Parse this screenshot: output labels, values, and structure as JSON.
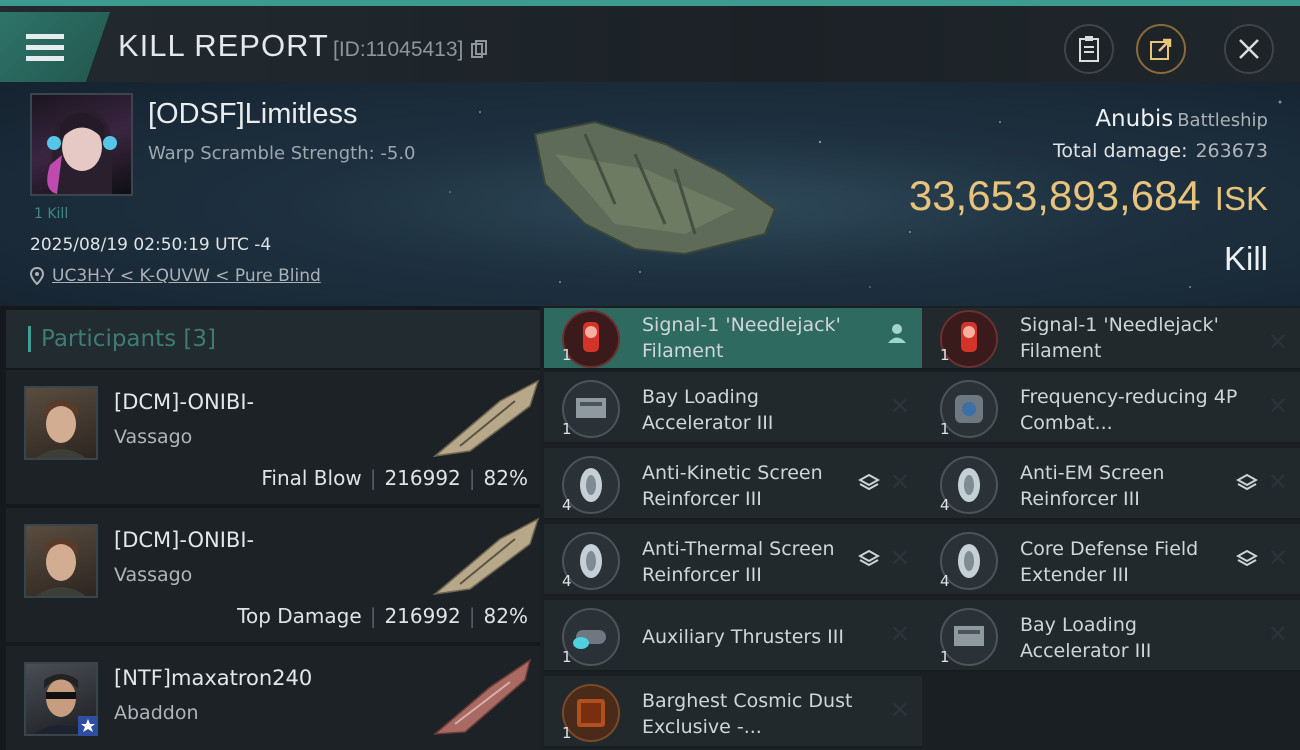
{
  "header": {
    "title": "KILL REPORT",
    "report_id": "[ID:11045413]"
  },
  "victim": {
    "name": "[ODSF]Limitless",
    "warp_scramble": "Warp Scramble Strength: -5.0",
    "kill_count": "1 Kill",
    "datetime": "2025/08/19 02:50:19 UTC -4",
    "location": "UC3H-Y < K-QUVW < Pure Blind"
  },
  "ship": {
    "name": "Anubis",
    "class": "Battleship",
    "total_damage_label": "Total damage:",
    "total_damage": "263673",
    "isk_value": "33,653,893,684",
    "isk_unit": "ISK",
    "result": "Kill"
  },
  "participants": {
    "title": "Participants",
    "count": "[3]",
    "list": [
      {
        "name": "[DCM]-ONIBI-",
        "ship": "Vassago",
        "role": "Final Blow",
        "damage": "216992",
        "percent": "82%"
      },
      {
        "name": "[DCM]-ONIBI-",
        "ship": "Vassago",
        "role": "Top Damage",
        "damage": "216992",
        "percent": "82%"
      },
      {
        "name": "[NTF]maxatron240",
        "ship": "Abaddon"
      }
    ]
  },
  "modules": [
    {
      "name": "Signal-1 'Needlejack' Filament",
      "qty": "1",
      "icon": "filament-icon"
    },
    {
      "name": "Signal-1 'Needlejack' Filament",
      "qty": "1",
      "icon": "filament-icon"
    },
    {
      "name": "Bay Loading Accelerator III",
      "qty": "1",
      "icon": "bay-loading-icon"
    },
    {
      "name": "Frequency-reducing 4P Combat...",
      "qty": "1",
      "icon": "combat-module-icon"
    },
    {
      "name": "Anti-Kinetic Screen Reinforcer III",
      "qty": "4",
      "icon": "screen-reinforcer-icon"
    },
    {
      "name": "Anti-EM Screen Reinforcer III",
      "qty": "4",
      "icon": "screen-reinforcer-icon"
    },
    {
      "name": "Anti-Thermal Screen Reinforcer III",
      "qty": "4",
      "icon": "screen-reinforcer-icon"
    },
    {
      "name": "Core Defense Field Extender III",
      "qty": "4",
      "icon": "shield-extender-icon"
    },
    {
      "name": "Auxiliary Thrusters III",
      "qty": "1",
      "icon": "thruster-icon"
    },
    {
      "name": "Bay Loading Accelerator III",
      "qty": "1",
      "icon": "bay-loading-icon"
    },
    {
      "name": "Barghest Cosmic Dust Exclusive -...",
      "qty": "1",
      "icon": "cosmic-dust-icon"
    }
  ],
  "colors": {
    "accent": "#3da092",
    "isk": "#e7c37c",
    "panel": "#22292d"
  }
}
